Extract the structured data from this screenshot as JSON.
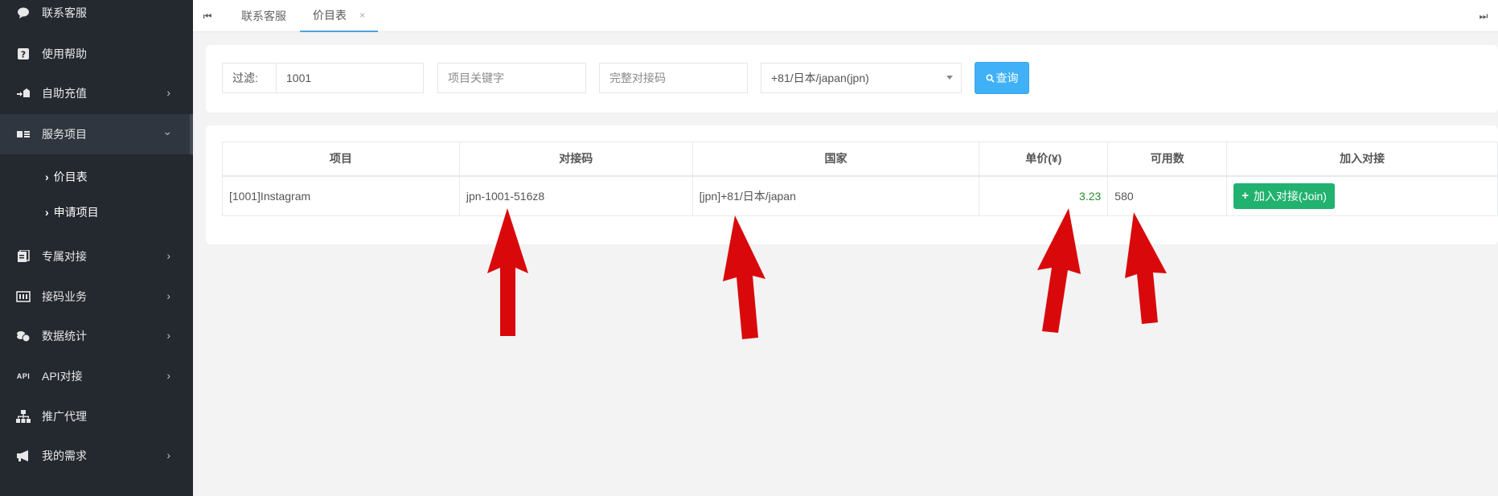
{
  "sidebar": {
    "items": [
      {
        "label": "联系客服",
        "icon": "chat-bubble-icon",
        "has_arrow": false
      },
      {
        "label": "使用帮助",
        "icon": "help-icon",
        "has_arrow": false
      },
      {
        "label": "自助充值",
        "icon": "recharge-icon",
        "has_arrow": true
      },
      {
        "label": "服务项目",
        "icon": "service-card-icon",
        "has_arrow": true,
        "expanded": true
      },
      {
        "label": "专属对接",
        "icon": "dedicated-icon",
        "has_arrow": true
      },
      {
        "label": "接码业务",
        "icon": "code-business-icon",
        "has_arrow": true
      },
      {
        "label": "数据统计",
        "icon": "coins-icon",
        "has_arrow": true
      },
      {
        "label": "API对接",
        "icon": "api-icon",
        "has_arrow": true,
        "icon_text": "API"
      },
      {
        "label": "推广代理",
        "icon": "sitemap-icon",
        "has_arrow": false
      },
      {
        "label": "我的需求",
        "icon": "megaphone-icon",
        "has_arrow": true
      }
    ],
    "sub_items": [
      {
        "label": "价目表"
      },
      {
        "label": "申请项目"
      }
    ]
  },
  "tabs": {
    "items": [
      {
        "label": "联系客服"
      },
      {
        "label": "价目表",
        "close": "×"
      }
    ]
  },
  "filter": {
    "label": "过滤:",
    "project_id_value": "1001",
    "keyword_placeholder": "项目关键字",
    "code_placeholder": "完整对接码",
    "country_selected": "+81/日本/japan(jpn)",
    "query_label": "查询"
  },
  "table": {
    "headers": [
      "项目",
      "对接码",
      "国家",
      "单价(¥)",
      "可用数",
      "加入对接"
    ],
    "rows": [
      {
        "project": "[1001]Instagram",
        "code": "jpn-1001-516z8",
        "country": "[jpn]+81/日本/japan",
        "price": "3.23",
        "available": "580",
        "join_label": "加入对接(Join)"
      }
    ]
  },
  "colors": {
    "sidebar_bg": "#24282f",
    "tab_active_underline": "#4aa3df",
    "query_button": "#40b1f6",
    "join_button": "#21b26f",
    "price_text": "#2e8b2e",
    "annotation_arrow": "#d9090b"
  }
}
